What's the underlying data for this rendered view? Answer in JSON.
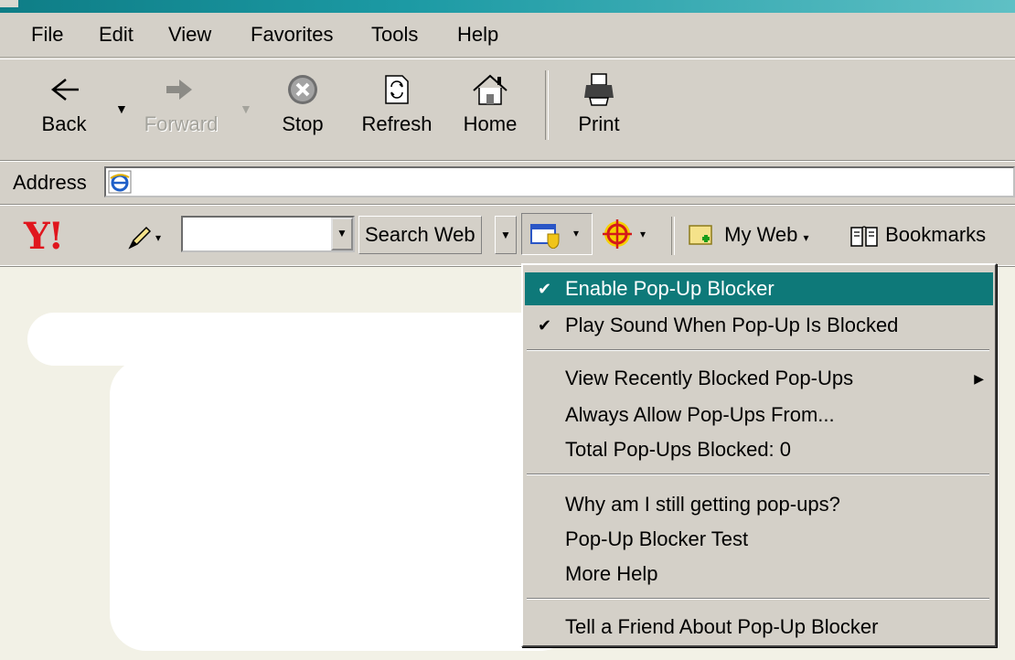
{
  "menubar": {
    "items": [
      "File",
      "Edit",
      "View",
      "Favorites",
      "Tools",
      "Help"
    ]
  },
  "toolbar": {
    "back": "Back",
    "forward": "Forward",
    "stop": "Stop",
    "refresh": "Refresh",
    "home": "Home",
    "print": "Print"
  },
  "address": {
    "label": "Address",
    "value": ""
  },
  "yahoo": {
    "logo": "Y!",
    "search_value": "",
    "search_label": "Search Web",
    "myweb_label": "My Web",
    "bookmarks_label": "Bookmarks"
  },
  "popup_menu": {
    "group1": [
      {
        "label": "Enable Pop-Up Blocker",
        "checked": true,
        "highlighted": true
      },
      {
        "label": "Play Sound When Pop-Up Is Blocked",
        "checked": true,
        "highlighted": false
      }
    ],
    "group2": [
      {
        "label": "View Recently Blocked Pop-Ups",
        "submenu": true
      },
      {
        "label": "Always Allow Pop-Ups From..."
      },
      {
        "label": "Total Pop-Ups Blocked: 0"
      }
    ],
    "group3": [
      {
        "label": "Why am I still getting pop-ups?"
      },
      {
        "label": "Pop-Up Blocker Test"
      },
      {
        "label": "More Help"
      }
    ],
    "group4": [
      {
        "label": "Tell a Friend About Pop-Up Blocker"
      }
    ]
  },
  "colors": {
    "menu_highlight": "#0e7979",
    "chrome": "#d4d0c8",
    "yahoo_red": "#e0161d",
    "content_bg": "#f2f1e6"
  },
  "icons": [
    "back-arrow-icon",
    "forward-arrow-icon",
    "stop-icon",
    "refresh-icon",
    "home-icon",
    "print-icon",
    "ie-page-icon",
    "pencil-icon",
    "popup-blocker-icon",
    "target-icon",
    "my-web-icon",
    "bookmarks-icon",
    "checkmark-icon",
    "submenu-arrow-icon"
  ]
}
